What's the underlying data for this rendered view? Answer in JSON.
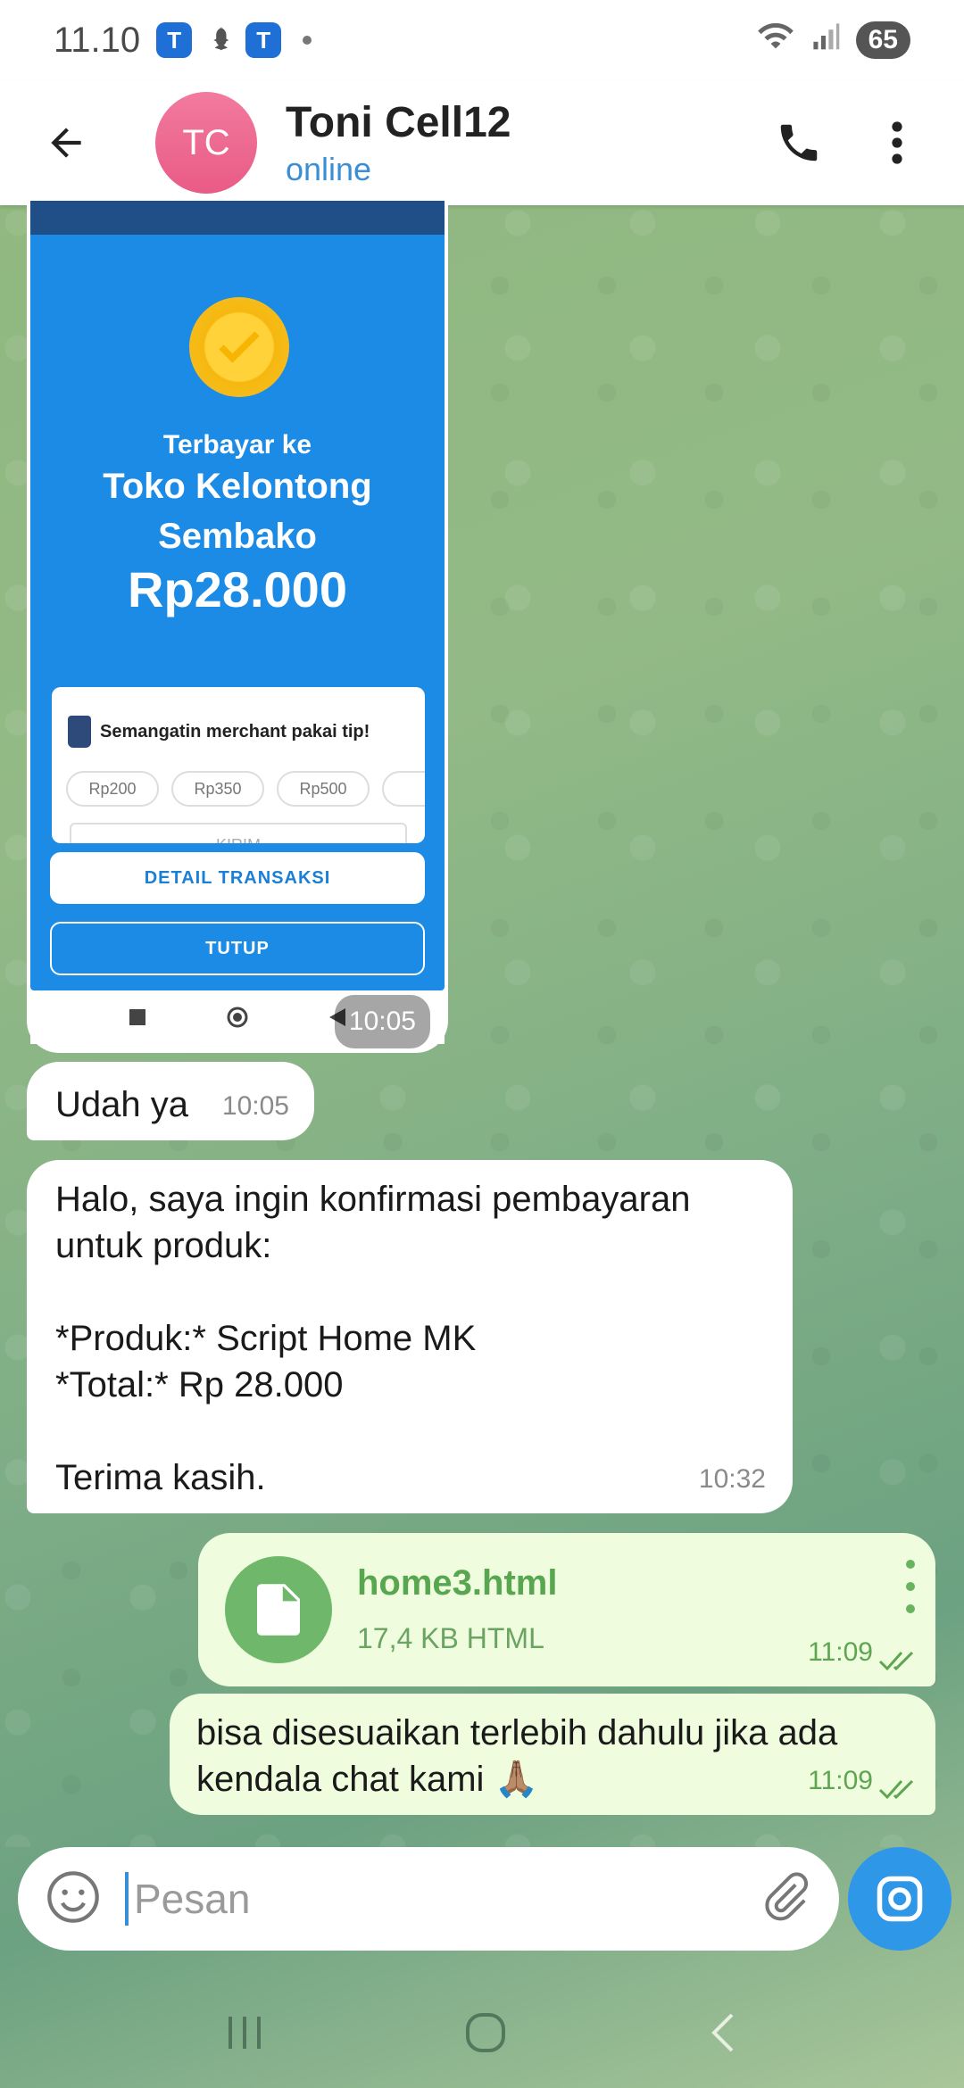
{
  "status_bar": {
    "time": "11.10",
    "battery": "65",
    "notif_icons": [
      "T",
      "T"
    ]
  },
  "header": {
    "avatar_initials": "TC",
    "contact_name": "Toni Cell12",
    "contact_status": "online"
  },
  "image_message": {
    "paid_to_label": "Terbayar ke",
    "merchant_line1": "Toko Kelontong",
    "merchant_line2": "Sembako",
    "amount": "Rp28.000",
    "tip_title": "Semangatin merchant pakai tip!",
    "tip_options": [
      "Rp200",
      "Rp350",
      "Rp500"
    ],
    "tip_send": "KIRIM",
    "detail_button": "DETAIL TRANSAKSI",
    "close_button": "TUTUP",
    "time": "10:05"
  },
  "messages": [
    {
      "text": "Udah ya",
      "time": "10:05"
    },
    {
      "lines": [
        "Halo, saya ingin konfirmasi pembayaran",
        "untuk produk:",
        "",
        "*Produk:* Script Home MK",
        "*Total:* Rp 28.000",
        "",
        "Terima kasih."
      ],
      "time": "10:32"
    }
  ],
  "file_message": {
    "name": "home3.html",
    "size": "17,4 KB HTML",
    "time": "11:09"
  },
  "outgoing_message": {
    "line1": "bisa disesuaikan terlebih dahulu jika ada",
    "line2": "kendala chat kami 🙏🏽",
    "time": "11:09"
  },
  "composer": {
    "placeholder": "Pesan"
  },
  "colors": {
    "accent": "#2f97e7",
    "outgoing_bubble": "#effdde",
    "avatar": "#e95b86"
  }
}
